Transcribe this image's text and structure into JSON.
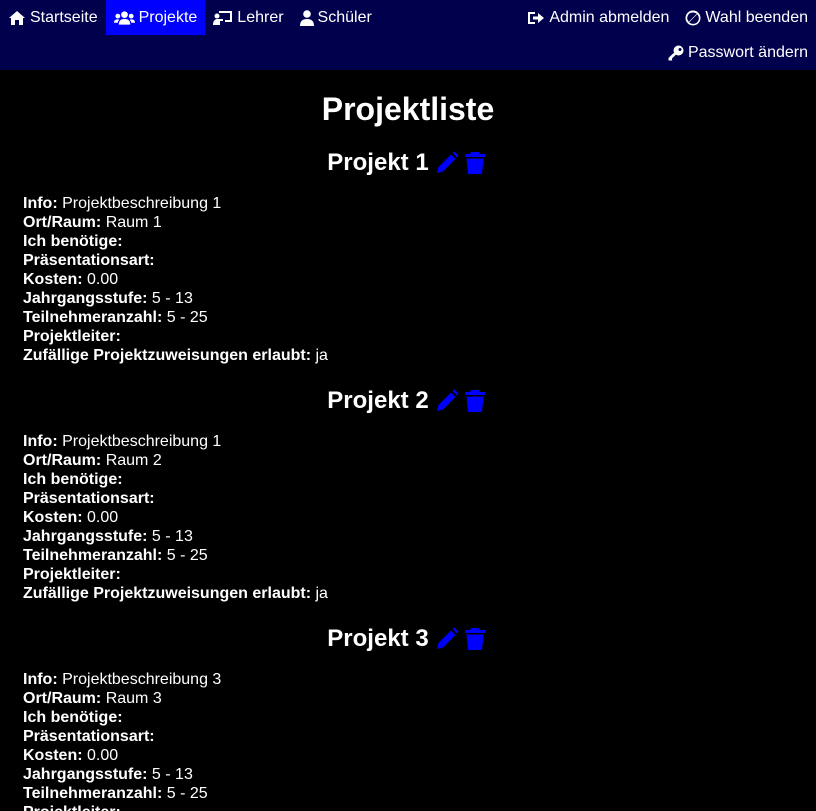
{
  "nav": {
    "home": "Startseite",
    "projects": "Projekte",
    "teachers": "Lehrer",
    "students": "Schüler",
    "logout": "Admin abmelden",
    "end_vote": "Wahl beenden",
    "change_password": "Passwort ändern"
  },
  "page_title": "Projektliste",
  "labels": {
    "info": "Info:",
    "room": "Ort/Raum:",
    "needs": "Ich benötige:",
    "presentation": "Präsentationsart:",
    "cost": "Kosten:",
    "grade": "Jahrgangsstufe:",
    "participants": "Teilnehmeranzahl:",
    "leader": "Projektleiter:",
    "random": "Zufällige Projektzuweisungen erlaubt:"
  },
  "projects": [
    {
      "title": "Projekt 1",
      "info": "Projektbeschreibung 1",
      "room": "Raum 1",
      "needs": "",
      "presentation": "",
      "cost": "0.00",
      "grade": "5 - 13",
      "participants": "5 - 25",
      "leader": "",
      "random": "ja"
    },
    {
      "title": "Projekt 2",
      "info": "Projektbeschreibung 1",
      "room": "Raum 2",
      "needs": "",
      "presentation": "",
      "cost": "0.00",
      "grade": "5 - 13",
      "participants": "5 - 25",
      "leader": "",
      "random": "ja"
    },
    {
      "title": "Projekt 3",
      "info": "Projektbeschreibung 3",
      "room": "Raum 3",
      "needs": "",
      "presentation": "",
      "cost": "0.00",
      "grade": "5 - 13",
      "participants": "5 - 25",
      "leader": "",
      "random": ""
    }
  ],
  "colors": {
    "navbar": "#00004d",
    "active_tab": "#0000ff",
    "icon_blue": "#0000ff",
    "background": "#000000",
    "text": "#ffffff"
  }
}
